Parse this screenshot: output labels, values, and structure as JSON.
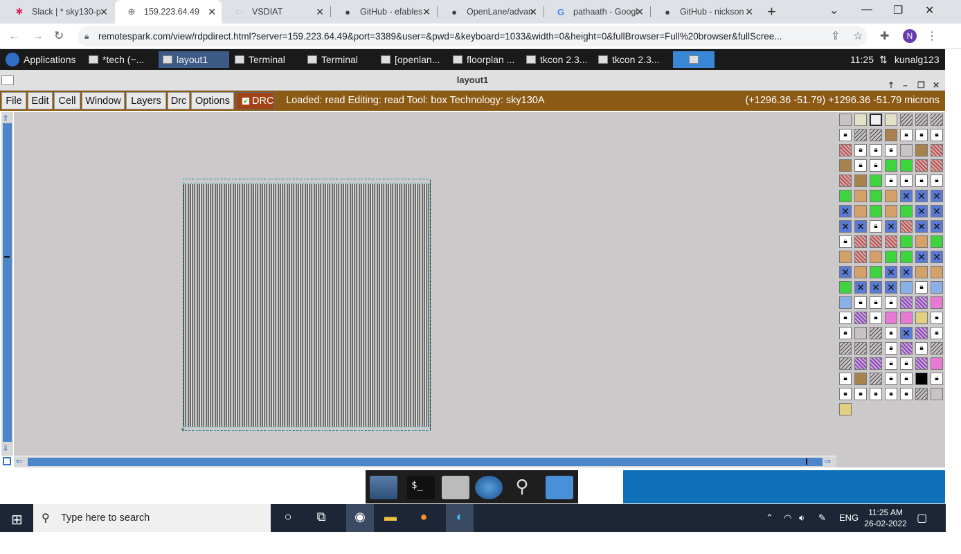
{
  "browser": {
    "tabs": [
      {
        "label": "Slack | * sky130-p",
        "icon": "slack-icon",
        "active": false
      },
      {
        "label": "159.223.64.49",
        "icon": "globe-icon",
        "active": true
      },
      {
        "label": "VSDIAT",
        "icon": "page-icon",
        "active": false
      },
      {
        "label": "GitHub - efables",
        "icon": "github-icon",
        "active": false
      },
      {
        "label": "OpenLane/advan",
        "icon": "github-icon",
        "active": false
      },
      {
        "label": "pathaath - Googl",
        "icon": "google-icon",
        "active": false
      },
      {
        "label": "GitHub - nickson",
        "icon": "github-icon",
        "active": false
      }
    ],
    "url": "remotespark.com/view/rdpdirect.html?server=159.223.64.49&port=3389&user=&pwd=&keyboard=1033&width=0&height=0&fullBrowser=Full%20browser&fullScree...",
    "profile_initial": "N"
  },
  "panel": {
    "applications_label": "Applications",
    "tasks": [
      {
        "label": "*tech (~..."
      },
      {
        "label": "layout1",
        "active": true
      },
      {
        "label": "Terminal"
      },
      {
        "label": "Terminal"
      },
      {
        "label": "[openlan..."
      },
      {
        "label": "floorplan ..."
      },
      {
        "label": "tkcon 2.3..."
      },
      {
        "label": "tkcon 2.3..."
      }
    ],
    "time": "11:25",
    "user": "kunalg123"
  },
  "window": {
    "title": "layout1"
  },
  "magic": {
    "menus": [
      "File",
      "Edit",
      "Cell",
      "Window",
      "Layers",
      "Drc",
      "Options"
    ],
    "drc_label": "DRC",
    "status": "Loaded: read Editing: read Tool: box  Technology: sky130A",
    "coords": "(+1296.36 -51.79) +1296.36 -51.79 microns"
  },
  "taskbar": {
    "search_placeholder": "Type here to search",
    "language": "ENG",
    "time": "11:25 AM",
    "date": "26-02-2022"
  },
  "palette_colors": {
    "red": "#d44848",
    "green": "#3ed43e",
    "tan": "#d4a16a",
    "blue": "#5a7ad4",
    "purple": "#9a3ad4",
    "pink": "#e87ad4",
    "brown": "#a8824e"
  }
}
